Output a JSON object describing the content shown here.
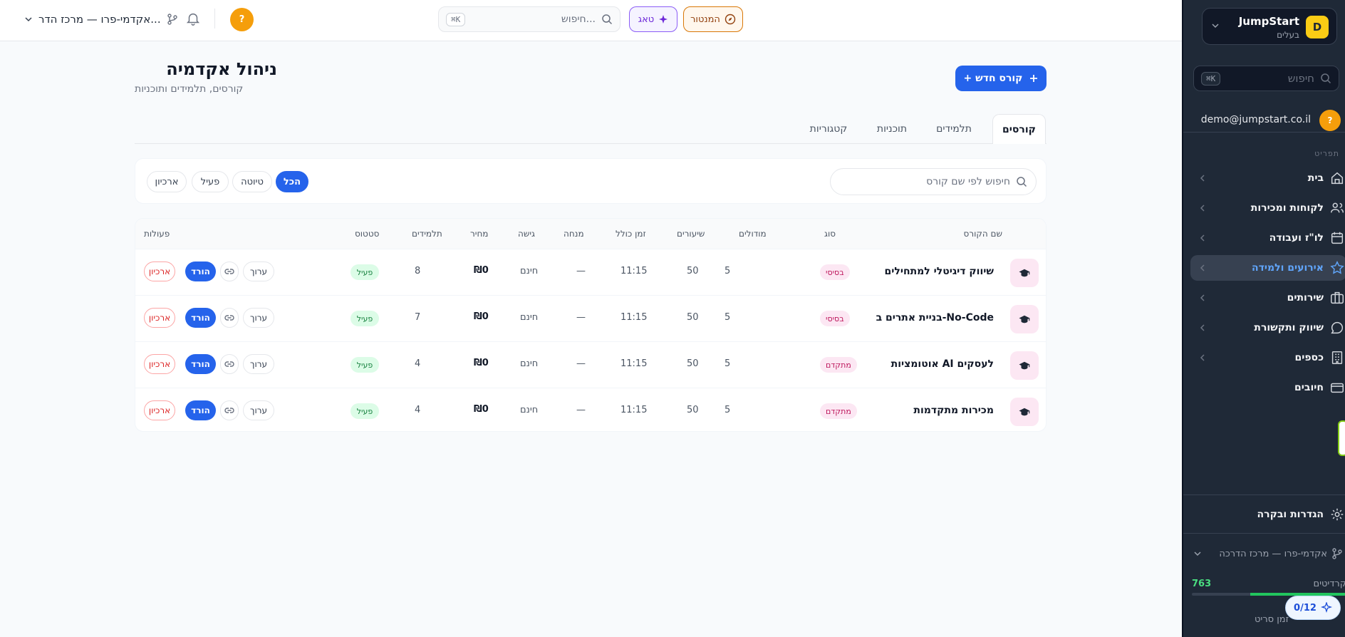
{
  "topbar": {
    "workspace": "אקדמי-פרו — מרכז הדר...",
    "avatar": "?",
    "search_placeholder": "חיפוש...",
    "search_kbd": "⌘K",
    "tag_button": "טאג",
    "navigator_button": "המנטור"
  },
  "sidebar": {
    "brand_name": "JumpStart",
    "brand_sub": "בעלים",
    "brand_logo": "D",
    "search_placeholder": "חיפוש",
    "search_kbd": "⌘K",
    "user_email": "demo@jumpstart.co.il",
    "user_avatar": "?",
    "section_label": "תפריט",
    "items": [
      {
        "label": "בית",
        "icon": "home-icon"
      },
      {
        "label": "לקוחות ומכירות",
        "icon": "users-icon"
      },
      {
        "label": "לו\"ז ועבודה",
        "icon": "calendar-icon"
      },
      {
        "label": "אירועים ולמידה",
        "icon": "star-icon"
      },
      {
        "label": "שירותים",
        "icon": "briefcase-icon"
      },
      {
        "label": "שיווק ותקשורת",
        "icon": "chat-icon"
      },
      {
        "label": "כספים",
        "icon": "building-icon"
      },
      {
        "label": "חיובים",
        "icon": "card-icon"
      }
    ],
    "settings_label": "הגדרות ובקרה",
    "workspace": "אקדמי-פרו — מרכז הדרכה",
    "credits_label": "קרדיטים",
    "credits_value": "763",
    "credits_fraction": 0.62,
    "bottom_text": "זמן סריט",
    "progress_pill": "0/12"
  },
  "page": {
    "title": "ניהול אקדמיה",
    "subtitle": "קורסים, תלמידים ותוכניות",
    "new_course_button": "+ קורס חדש"
  },
  "tabs": [
    "קורסים",
    "תלמידים",
    "תוכניות",
    "קטגוריות"
  ],
  "filters": {
    "search_placeholder": "חיפוש לפי שם קורס",
    "chips": [
      "הכל",
      "טיוטה",
      "פעיל",
      "ארכיון"
    ]
  },
  "table": {
    "headers": {
      "name": "שם הקורס",
      "type": "סוג",
      "modules": "מודולים",
      "lessons": "שיעורים",
      "duration": "זמן כולל",
      "instructor": "מנחה",
      "access": "גישה",
      "price": "מחיר",
      "students": "תלמידים",
      "status": "סטטוס",
      "actions": "פעולות"
    },
    "actions": {
      "edit": "ערוך",
      "download": "הורד",
      "archive": "ארכיון"
    },
    "rows": [
      {
        "name": "שיווק דיגיטלי למתחילים",
        "type": "בסיסי",
        "modules": "5",
        "lessons": "50",
        "duration": "11:15",
        "instructor": "—",
        "access": "חינם",
        "price": "₪0",
        "students": "8",
        "status": "פעיל"
      },
      {
        "name": "בניית אתרים ב-No-Code",
        "type": "בסיסי",
        "modules": "5",
        "lessons": "50",
        "duration": "11:15",
        "instructor": "—",
        "access": "חינם",
        "price": "₪0",
        "students": "7",
        "status": "פעיל"
      },
      {
        "name": "אוטומציות AI לעסקים",
        "type": "מתקדם",
        "modules": "5",
        "lessons": "50",
        "duration": "11:15",
        "instructor": "—",
        "access": "חינם",
        "price": "₪0",
        "students": "4",
        "status": "פעיל"
      },
      {
        "name": "מכירות מתקדמות",
        "type": "מתקדם",
        "modules": "5",
        "lessons": "50",
        "duration": "11:15",
        "instructor": "—",
        "access": "חינם",
        "price": "₪0",
        "students": "4",
        "status": "פעיל"
      }
    ]
  },
  "colors": {
    "accent": "#2563eb",
    "sidebar_bg": "#1f2937",
    "active": "#60a5fa",
    "success": "#22c55e"
  }
}
